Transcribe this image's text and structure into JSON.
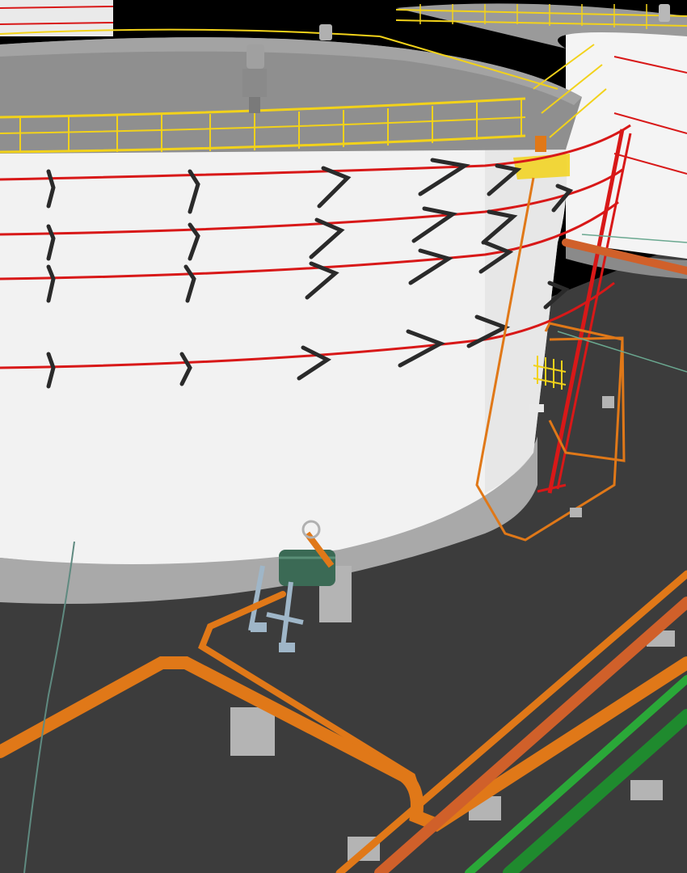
{
  "viewport": {
    "view_label": "",
    "colors": {
      "sky": "#000000",
      "ground": "#3c3c3c",
      "tank_wall": "#f2f2f2",
      "tank_roof": "#8f8f8f",
      "tank_base": "#a9a9a9",
      "railing": "#f2d21a",
      "fire_ring": "#d81818",
      "pipe_orange": "#e07818",
      "pipe_rust": "#d0602a",
      "pipe_green": "#2aa838",
      "bracket": "#2a2a2a",
      "support": "#b4b4b4"
    },
    "objects": [
      "storage-tank-main",
      "storage-tank-background",
      "roof-railing",
      "stair-landing",
      "fire-water-rings",
      "ring-brackets",
      "riser-pipe-red",
      "riser-pipe-orange",
      "pump-skid",
      "pipe-rack",
      "earthing-cable"
    ]
  }
}
